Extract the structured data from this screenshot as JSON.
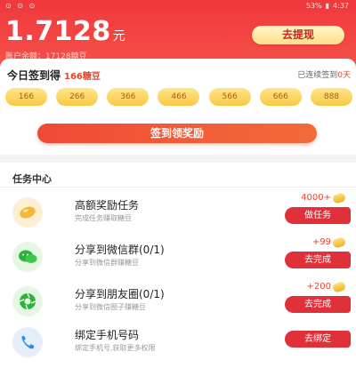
{
  "statusbar": {
    "left": "⊙ ⊙ ⊙",
    "battery": "53%",
    "time": "4:37"
  },
  "balance": {
    "amount": "1.7128",
    "unit": "元",
    "sub": "账户余额：17128糖豆"
  },
  "withdraw": {
    "label": "去提现"
  },
  "checkin": {
    "title": "今日签到得",
    "beans": "166糖豆",
    "streak_prefix": "已连续签到",
    "streak_days": "0天",
    "days": [
      "166",
      "266",
      "366",
      "466",
      "566",
      "666",
      "888"
    ],
    "claim_label": "签到领奖励"
  },
  "tasks": {
    "title": "任务中心",
    "items": [
      {
        "name": "高额奖励任务",
        "desc": "完成任务赚取糖豆",
        "reward": "4000+",
        "button": "做任务",
        "icon": "bean-icon"
      },
      {
        "name": "分享到微信群(0/1)",
        "desc": "分享到微信群赚糖豆",
        "reward": "+99",
        "button": "去完成",
        "icon": "wechat-icon"
      },
      {
        "name": "分享到朋友圈(0/1)",
        "desc": "分享到微信圈子赚糖豆",
        "reward": "+200",
        "button": "去完成",
        "icon": "moments-icon"
      },
      {
        "name": "绑定手机号码",
        "desc": "绑定手机号,获取更多权限",
        "reward": "",
        "button": "去绑定",
        "icon": "phone-icon"
      }
    ]
  },
  "colors": {
    "primary": "#f0383d",
    "accent": "#e8452c",
    "gold": "#f9c945"
  }
}
